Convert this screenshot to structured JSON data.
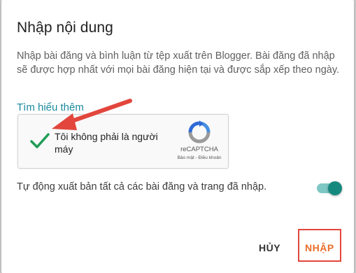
{
  "dialog": {
    "title": "Nhập nội dung",
    "description": "Nhập bài đăng và bình luận từ tệp xuất trên Blogger. Bài đăng đã nhập sẽ được hợp nhất với mọi bài đăng hiện tại và được sắp xếp theo ngày.",
    "learn_more": "Tìm hiểu thêm"
  },
  "captcha": {
    "label": "Tôi không phải là người máy",
    "brand": "reCAPTCHA",
    "terms": "Bảo mật - Điều khoản",
    "checked": true,
    "icon": "recaptcha-logo-icon"
  },
  "auto_publish": {
    "label": "Tự động xuất bản tất cả các bài đăng và trang đã nhập.",
    "enabled": true
  },
  "actions": {
    "cancel": "HỦY",
    "import": "NHẬP"
  },
  "colors": {
    "link": "#1a8a9e",
    "toggle_on": "#16897f",
    "import_button": "#e96d2a",
    "highlight": "#e2463c",
    "check": "#1f9d55"
  }
}
